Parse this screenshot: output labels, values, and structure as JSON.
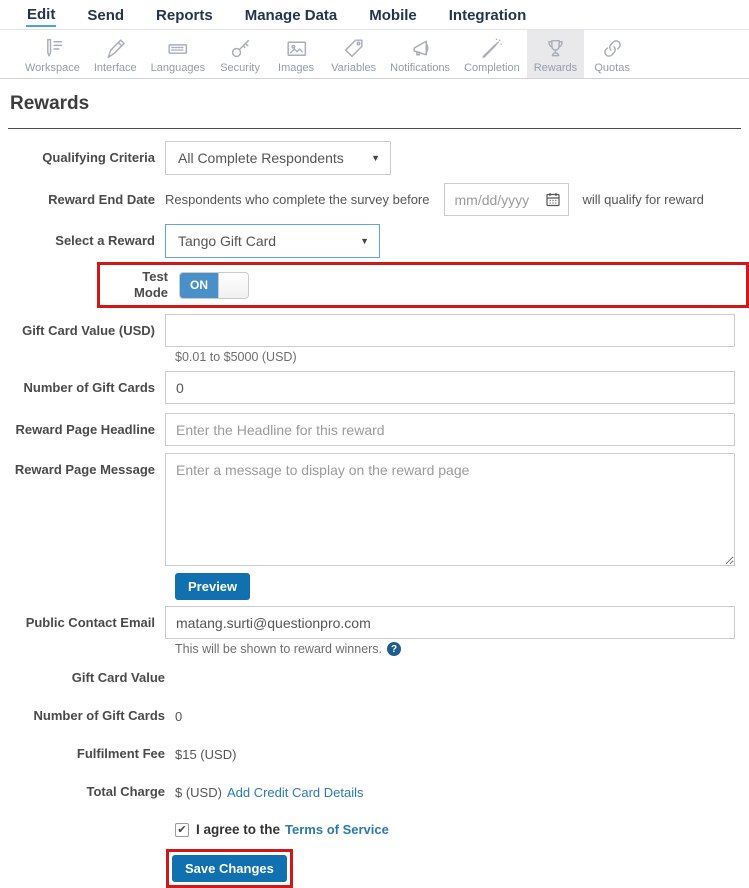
{
  "nav": {
    "items": [
      {
        "label": "Edit",
        "active": true
      },
      {
        "label": "Send",
        "active": false
      },
      {
        "label": "Reports",
        "active": false
      },
      {
        "label": "Manage Data",
        "active": false
      },
      {
        "label": "Mobile",
        "active": false
      },
      {
        "label": "Integration",
        "active": false
      }
    ]
  },
  "toolbar": {
    "items": [
      {
        "label": "Workspace",
        "icon": "workspace-icon",
        "selected": false
      },
      {
        "label": "Interface",
        "icon": "interface-icon",
        "selected": false
      },
      {
        "label": "Languages",
        "icon": "languages-icon",
        "selected": false
      },
      {
        "label": "Security",
        "icon": "security-icon",
        "selected": false
      },
      {
        "label": "Images",
        "icon": "images-icon",
        "selected": false
      },
      {
        "label": "Variables",
        "icon": "variables-icon",
        "selected": false
      },
      {
        "label": "Notifications",
        "icon": "notifications-icon",
        "selected": false
      },
      {
        "label": "Completion",
        "icon": "completion-icon",
        "selected": false
      },
      {
        "label": "Rewards",
        "icon": "rewards-icon",
        "selected": true
      },
      {
        "label": "Quotas",
        "icon": "quotas-icon",
        "selected": false
      }
    ]
  },
  "page": {
    "title": "Rewards"
  },
  "form": {
    "qualifying_criteria": {
      "label": "Qualifying Criteria",
      "value": "All Complete Respondents"
    },
    "reward_end_date": {
      "label": "Reward End Date",
      "prefix": "Respondents who complete the survey before",
      "placeholder": "mm/dd/yyyy",
      "suffix": "will qualify for reward"
    },
    "select_reward": {
      "label": "Select a Reward",
      "value": "Tango Gift Card"
    },
    "test_mode": {
      "label": "Test Mode",
      "state": "ON"
    },
    "gift_card_value": {
      "label": "Gift Card Value (USD)",
      "value": "",
      "helper": "$0.01 to $5000 (USD)"
    },
    "num_gift_cards": {
      "label": "Number of Gift Cards",
      "value": "0"
    },
    "headline": {
      "label": "Reward Page Headline",
      "placeholder": "Enter the Headline for this reward"
    },
    "message": {
      "label": "Reward Page Message",
      "placeholder": "Enter a message to display on the reward page"
    },
    "preview_label": "Preview",
    "contact_email": {
      "label": "Public Contact Email",
      "value": "matang.surti@questionpro.com",
      "helper": "This will be shown to reward winners."
    },
    "summary": [
      {
        "label": "Gift Card Value",
        "value": ""
      },
      {
        "label": "Number of Gift Cards",
        "value": "0"
      },
      {
        "label": "Fulfilment Fee",
        "value": "$15 (USD)"
      },
      {
        "label": "Total Charge",
        "value": "$ (USD)",
        "link": "Add Credit Card Details"
      }
    ],
    "agree": {
      "text": "I agree to the",
      "link": "Terms of Service",
      "checked": true
    },
    "save_label": "Save Changes"
  },
  "colors": {
    "accent_blue": "#1170b0",
    "toggle_blue": "#4a90c8",
    "highlight_red": "#d01818",
    "link_blue": "#2a7ab0",
    "nav_navy": "#22354f"
  }
}
